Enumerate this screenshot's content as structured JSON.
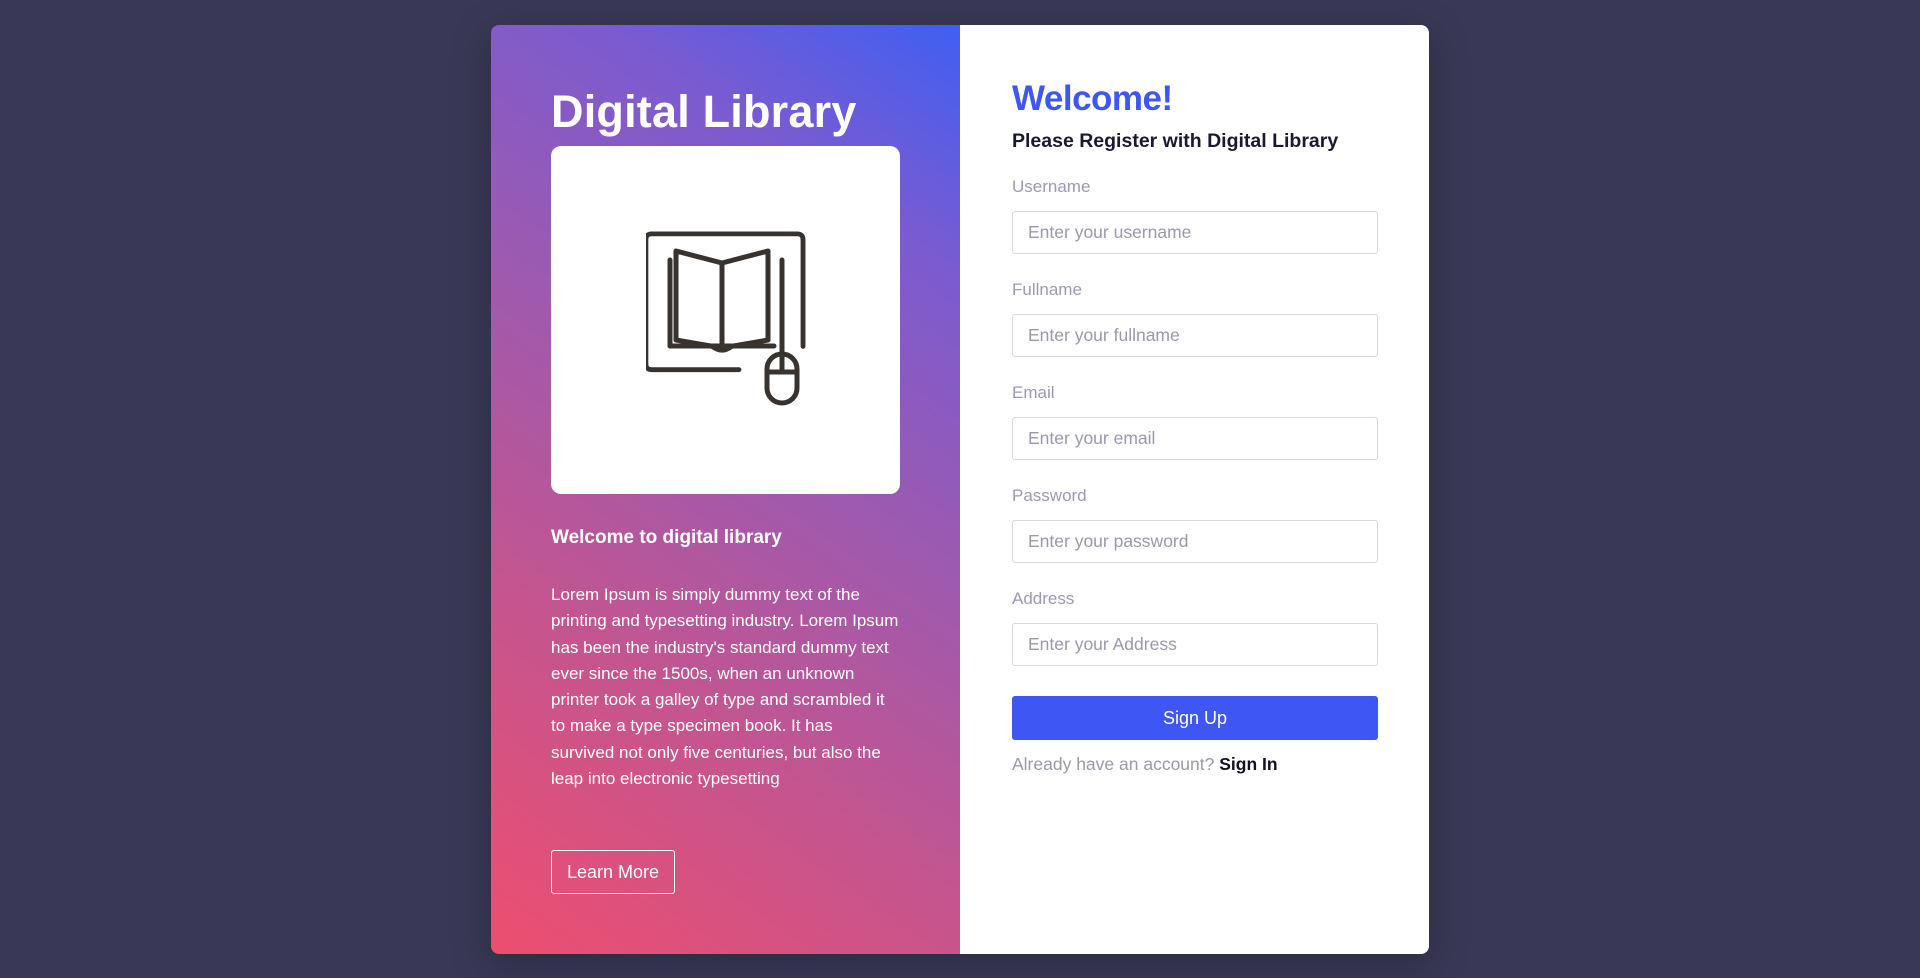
{
  "left_panel": {
    "title": "Digital Library",
    "image_icon": "book-computer-mouse-icon",
    "subtitle": "Welcome to digital library",
    "description": "Lorem Ipsum is simply dummy text of the printing and typesetting industry. Lorem Ipsum has been the industry's standard dummy text ever since the 1500s, when an unknown printer took a galley of type and scrambled it to make a type specimen book. It has survived not only five centuries, but also the leap into electronic typesetting",
    "learn_more_label": "Learn More"
  },
  "right_panel": {
    "heading": "Welcome!",
    "subheading": "Please Register with Digital Library",
    "fields": {
      "username": {
        "label": "Username",
        "placeholder": "Enter your username",
        "value": ""
      },
      "fullname": {
        "label": "Fullname",
        "placeholder": "Enter your fullname",
        "value": ""
      },
      "email": {
        "label": "Email",
        "placeholder": "Enter your email",
        "value": ""
      },
      "password": {
        "label": "Password",
        "placeholder": "Enter your password",
        "value": ""
      },
      "address": {
        "label": "Address",
        "placeholder": "Enter your Address",
        "value": ""
      }
    },
    "signup_label": "Sign Up",
    "account_prompt": "Already have an account?",
    "signin_label": "Sign In"
  },
  "colors": {
    "background": "#393957",
    "accent": "#3e56f4",
    "gradient_start": "#ee4e6f",
    "gradient_end": "#3f5ff2"
  }
}
